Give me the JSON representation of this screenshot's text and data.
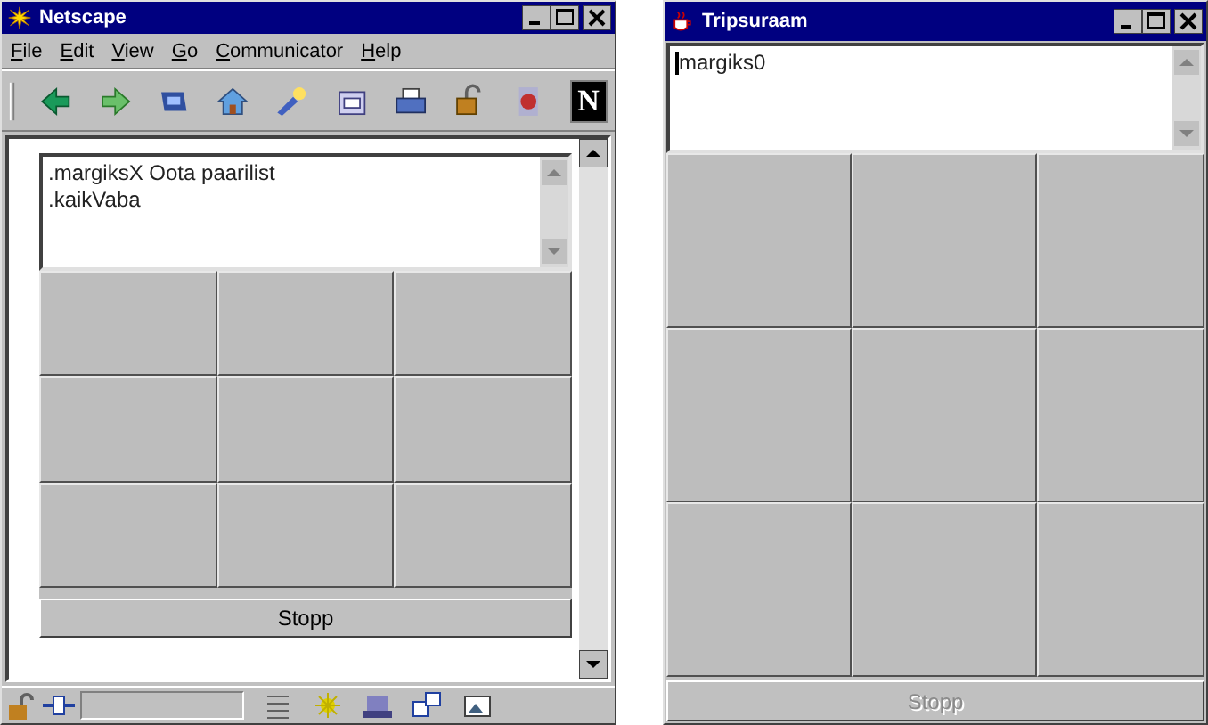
{
  "windows": [
    {
      "kind": "browser",
      "title": "Netscape",
      "menu": [
        "File",
        "Edit",
        "View",
        "Go",
        "Communicator",
        "Help"
      ],
      "logo": "N",
      "applet": {
        "text_lines": [
          ".margiksX Oota paarilist",
          ".kaikVaba"
        ],
        "focused": false,
        "cells": [
          {
            "kind": "empty"
          },
          {
            "kind": "empty"
          },
          {
            "kind": "empty"
          },
          {
            "kind": "empty"
          },
          {
            "kind": "empty"
          },
          {
            "kind": "empty"
          },
          {
            "kind": "empty"
          },
          {
            "kind": "empty"
          },
          {
            "kind": "empty"
          }
        ],
        "stop_button": {
          "label": "Stopp",
          "disabled": false
        }
      }
    },
    {
      "kind": "applet",
      "title": "Tripsuraam",
      "applet": {
        "text_lines": [
          "margiks0"
        ],
        "focused": true,
        "cells": [
          {
            "kind": "empty"
          },
          {
            "kind": "empty"
          },
          {
            "kind": "empty"
          },
          {
            "kind": "empty"
          },
          {
            "kind": "empty"
          },
          {
            "kind": "empty"
          },
          {
            "kind": "empty"
          },
          {
            "kind": "empty"
          },
          {
            "kind": "empty"
          }
        ],
        "stop_button": {
          "label": "Stopp",
          "disabled": true
        }
      }
    }
  ]
}
